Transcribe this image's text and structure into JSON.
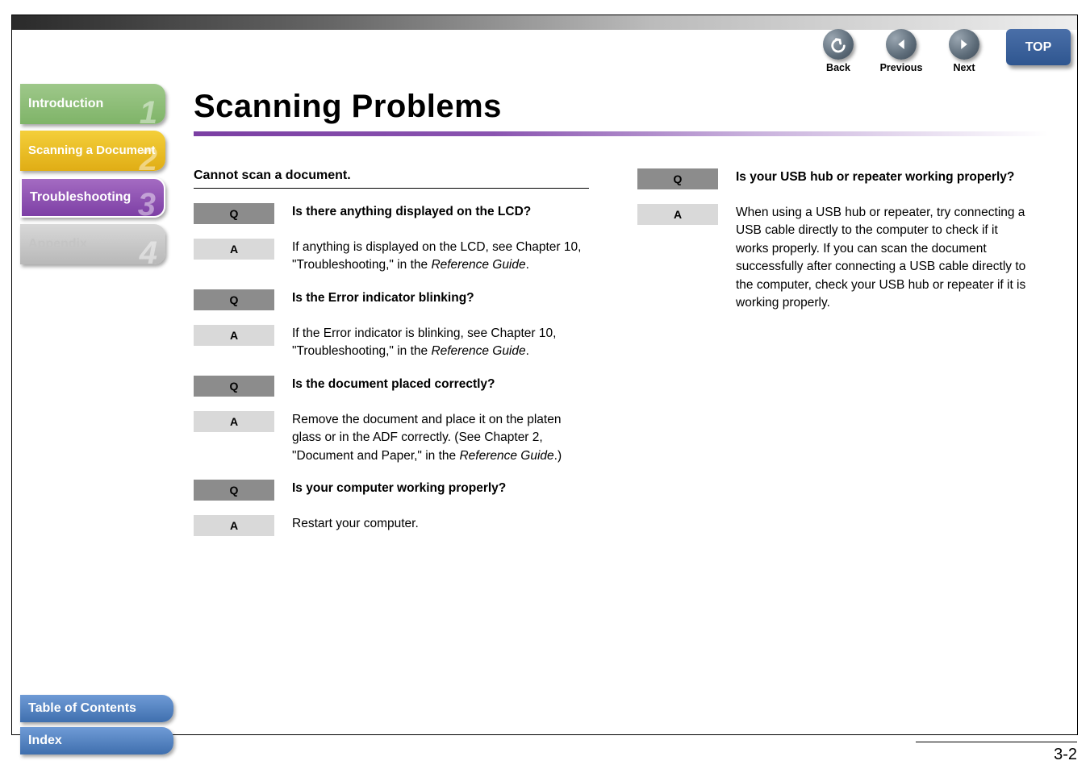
{
  "nav": {
    "back": "Back",
    "previous": "Previous",
    "next": "Next",
    "top": "TOP"
  },
  "sidebar": {
    "tabs": [
      {
        "label": "Introduction",
        "num": "1"
      },
      {
        "label": "Scanning a Document",
        "num": "2"
      },
      {
        "label": "Troubleshooting",
        "num": "3"
      },
      {
        "label": "Appendix",
        "num": "4"
      }
    ],
    "bottom": {
      "toc": "Table of Contents",
      "index": "Index"
    }
  },
  "title": "Scanning Problems",
  "section_header": "Cannot scan a document.",
  "qa_left": [
    {
      "q": "Is there anything displayed on the LCD?",
      "a_pre": "If anything is displayed on the LCD, see Chapter 10, \"Troubleshooting,\" in the ",
      "a_ital": "Reference Guide",
      "a_post": "."
    },
    {
      "q": "Is the Error indicator blinking?",
      "a_pre": "If the Error indicator is blinking, see Chapter 10, \"Troubleshooting,\" in the ",
      "a_ital": "Reference Guide",
      "a_post": "."
    },
    {
      "q": "Is the document placed correctly?",
      "a_pre": "Remove the document and place it on the platen glass or in the ADF correctly. (See Chapter 2, \"Document and Paper,\" in the ",
      "a_ital": "Reference Guide",
      "a_post": ".)"
    },
    {
      "q": "Is your computer working properly?",
      "a_pre": "Restart your computer.",
      "a_ital": "",
      "a_post": ""
    }
  ],
  "qa_right": {
    "q": "Is your USB hub or repeater working properly?",
    "a": "When using a USB hub or repeater, try connecting a USB cable directly to the computer to check if it works properly. If you can scan the document successfully after connecting a USB cable directly to the computer, check your USB hub or repeater if it is working properly."
  },
  "badges": {
    "q": "Q",
    "a": "A"
  },
  "page_number": "3-2"
}
